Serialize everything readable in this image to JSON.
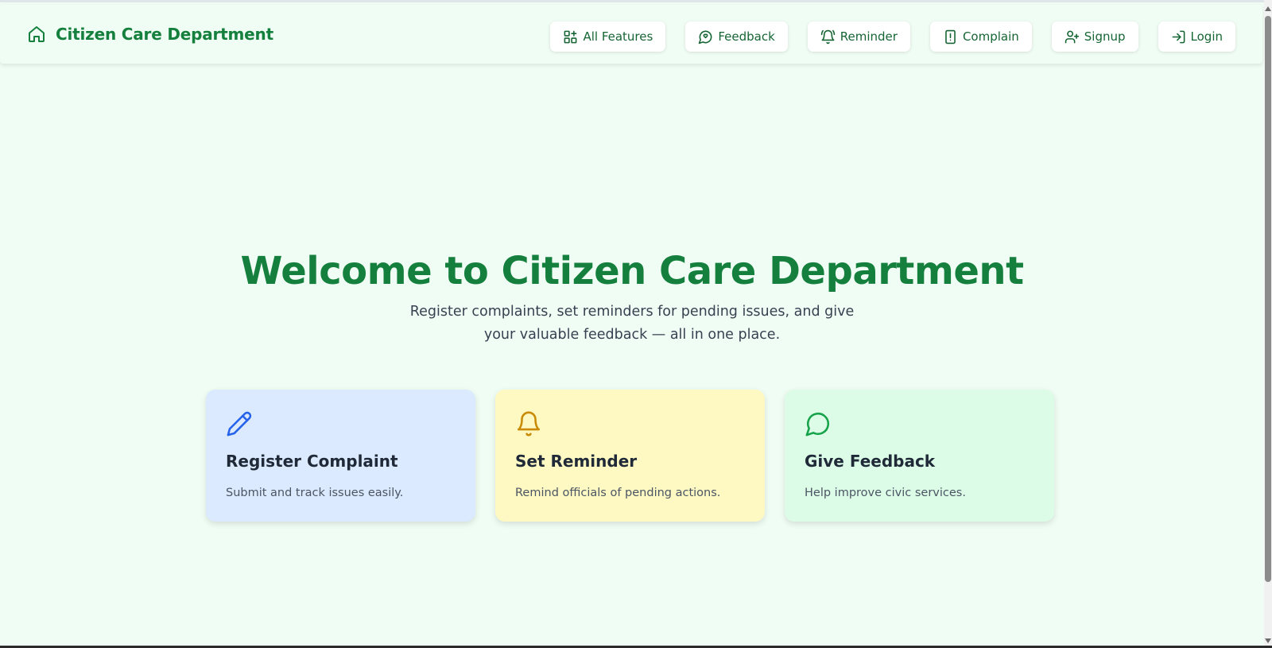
{
  "brand": {
    "title": "Citizen Care Department",
    "icon": "home-icon"
  },
  "nav": [
    {
      "key": "all-features",
      "label": "All Features",
      "icon": "grid-plus-icon"
    },
    {
      "key": "feedback",
      "label": "Feedback",
      "icon": "message-heart-icon"
    },
    {
      "key": "reminder",
      "label": "Reminder",
      "icon": "bell-ring-icon"
    },
    {
      "key": "complain",
      "label": "Complain",
      "icon": "file-alert-icon"
    },
    {
      "key": "signup",
      "label": "Signup",
      "icon": "user-plus-icon"
    },
    {
      "key": "login",
      "label": "Login",
      "icon": "log-in-icon"
    }
  ],
  "hero": {
    "title": "Welcome to Citizen Care Department",
    "subtitle": "Register complaints, set reminders for pending issues, and give your valuable feedback — all in one place."
  },
  "cards": [
    {
      "title": "Register Complaint",
      "description": "Submit and track issues easily.",
      "icon": "pencil-icon",
      "color": "#2563eb",
      "bg": "#dbeafe"
    },
    {
      "title": "Set Reminder",
      "description": "Remind officials of pending actions.",
      "icon": "bell-icon",
      "color": "#ca8a04",
      "bg": "#fef9c3"
    },
    {
      "title": "Give Feedback",
      "description": "Help improve civic services.",
      "icon": "message-circle-icon",
      "color": "#16a34a",
      "bg": "#dcfce7"
    }
  ],
  "colors": {
    "brand": "#15803d",
    "background": "#f0fdf4"
  }
}
